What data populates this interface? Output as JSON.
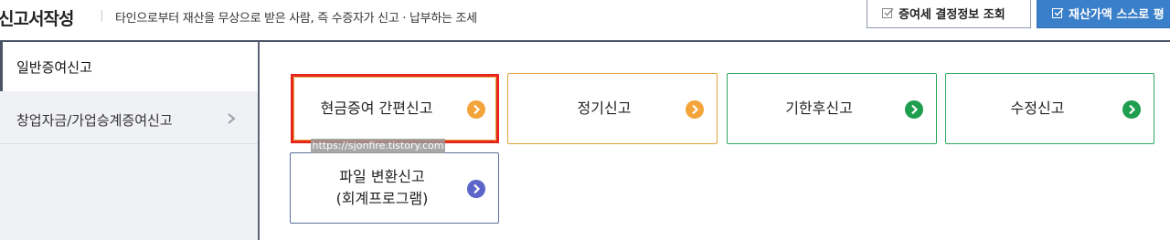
{
  "header": {
    "title": "신고서작성",
    "subtitle": "타인으로부터 재산을 무상으로 받은 사람, 즉 수증자가 신고 · 납부하는 조세",
    "btn_decision": "증여세 결정정보 조회",
    "btn_self_assess": "재산가액 스스로 평"
  },
  "sidebar": {
    "items": [
      {
        "label": "일반증여신고",
        "active": true
      },
      {
        "label": "창업자금/가업승계증여신고",
        "active": false
      }
    ]
  },
  "cards": [
    {
      "label": "현금증여 간편신고",
      "arrow_color": "#f3a43a"
    },
    {
      "label": "정기신고",
      "arrow_color": "#f3a43a"
    },
    {
      "label": "기한후신고",
      "arrow_color": "#1e9e4e"
    },
    {
      "label": "수정신고",
      "arrow_color": "#1e9e4e"
    },
    {
      "label_line1": "파일 변환신고",
      "label_line2": "(회계프로그램)",
      "arrow_color": "#5b66c8"
    }
  ],
  "watermark": "https://sjonfire.tistory.com",
  "colors": {
    "accent_blue": "#3a7fca",
    "highlight_red": "#e8251b",
    "dark_border": "#4b5466"
  }
}
